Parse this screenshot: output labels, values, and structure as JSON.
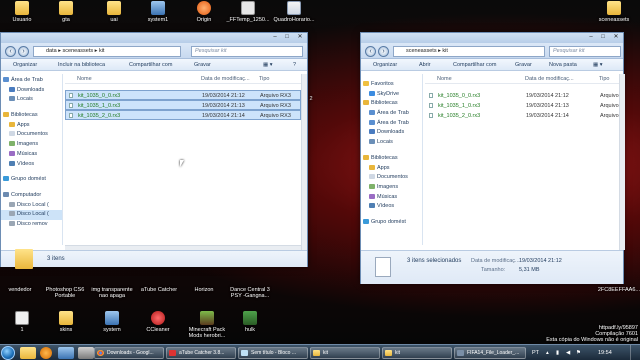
{
  "desktop": {
    "icons_top": [
      {
        "label": "Usuario",
        "icon": "user-folder-icon"
      },
      {
        "label": "gta",
        "icon": "folder-icon"
      },
      {
        "label": "uai",
        "icon": "folder-icon"
      },
      {
        "label": "system1",
        "icon": "system-icon"
      },
      {
        "label": "Origin",
        "icon": "origin-icon"
      },
      {
        "label": "_FFTemp_1250...",
        "icon": "file-icon"
      },
      {
        "label": "QuadroHorario...",
        "icon": "document-icon"
      },
      {
        "label": "sceneassets",
        "icon": "folder-icon"
      }
    ],
    "icons_middle": [
      {
        "label": "vendedor"
      },
      {
        "label": "Photoshop CS6 Portable"
      },
      {
        "label": "img transparente nao apaga"
      },
      {
        "label": "aTube Catcher"
      },
      {
        "label": "Horizon"
      },
      {
        "label": "Dance Central 3 PSY -Gangna..."
      }
    ],
    "icons_bottom": [
      {
        "label": "1",
        "icon": "file-icon"
      },
      {
        "label": "skins",
        "icon": "folder-icon"
      },
      {
        "label": "system",
        "icon": "system-icon"
      },
      {
        "label": "CCleaner",
        "icon": "ccleaner-icon"
      },
      {
        "label": "Minecraft Pack Mods herobri...",
        "icon": "minecraft-icon"
      },
      {
        "label": "hulk",
        "icon": "image-icon"
      }
    ],
    "right_text": [
      "2FC8EEFFAA6...",
      "httpadf.ly/95897",
      "Compilação 7601",
      "Esta cópia do Windows não é original"
    ],
    "edge_text": "2"
  },
  "left_window": {
    "breadcrumb": [
      "data",
      "sceneassets",
      "kit"
    ],
    "search_placeholder": "Pesquisar kit",
    "toolbar": [
      "Organizar",
      "Incluir na biblioteca",
      "Compartilhar com",
      "Gravar"
    ],
    "nav": [
      {
        "label": "Área de Trab",
        "icon": "desktop-icon"
      },
      {
        "label": "Downloads",
        "icon": "downloads-icon"
      },
      {
        "label": "Locais",
        "icon": "places-icon"
      },
      {
        "label": ""
      },
      {
        "label": "Bibliotecas",
        "icon": "libraries-icon"
      },
      {
        "label": "Apps",
        "icon": "folder-icon"
      },
      {
        "label": "Documentos",
        "icon": "documents-icon"
      },
      {
        "label": "Imagens",
        "icon": "images-icon"
      },
      {
        "label": "Músicas",
        "icon": "music-icon"
      },
      {
        "label": "Vídeos",
        "icon": "videos-icon"
      },
      {
        "label": ""
      },
      {
        "label": "Grupo domést",
        "icon": "homegroup-icon"
      },
      {
        "label": ""
      },
      {
        "label": "Computador",
        "icon": "computer-icon"
      },
      {
        "label": "Disco Local (",
        "icon": "disk-icon"
      },
      {
        "label": "Disco Local (",
        "icon": "disk-icon"
      },
      {
        "label": "Disco remov",
        "icon": "removable-disk-icon"
      }
    ],
    "columns": [
      "Nome",
      "Data de modificaç...",
      "Tipo"
    ],
    "files": [
      {
        "name": "kit_1035_0_0.rx3",
        "date": "19/03/2014 21:12",
        "type": "Arquivo RX3"
      },
      {
        "name": "kit_1035_1_0.rx3",
        "date": "19/03/2014 21:13",
        "type": "Arquivo RX3"
      },
      {
        "name": "kit_1035_2_0.rx3",
        "date": "19/03/2014 21:14",
        "type": "Arquivo RX3"
      }
    ],
    "status": "3 itens"
  },
  "right_window": {
    "breadcrumb": [
      "sceneassets",
      "kit"
    ],
    "search_placeholder": "Pesquisar kit",
    "toolbar": [
      "Organizar",
      "Abrir",
      "Compartilhar com",
      "Gravar",
      "Nova pasta"
    ],
    "nav": [
      {
        "label": "Favoritos",
        "icon": "favorites-icon"
      },
      {
        "label": "SkyDrive",
        "icon": "skydrive-icon"
      },
      {
        "label": "Bibliotecas",
        "icon": "libraries-icon"
      },
      {
        "label": "Área de Trab",
        "icon": "desktop-icon"
      },
      {
        "label": "Área de Trab",
        "icon": "desktop-icon"
      },
      {
        "label": "Downloads",
        "icon": "downloads-icon"
      },
      {
        "label": "Locais",
        "icon": "places-icon"
      },
      {
        "label": ""
      },
      {
        "label": "Bibliotecas",
        "icon": "libraries-icon"
      },
      {
        "label": "Apps",
        "icon": "folder-icon"
      },
      {
        "label": "Documentos",
        "icon": "documents-icon"
      },
      {
        "label": "Imagens",
        "icon": "images-icon"
      },
      {
        "label": "Músicas",
        "icon": "music-icon"
      },
      {
        "label": "Vídeos",
        "icon": "videos-icon"
      },
      {
        "label": ""
      },
      {
        "label": "Grupo domést",
        "icon": "homegroup-icon"
      }
    ],
    "columns": [
      "Nome",
      "Data de modificaç...",
      "Tipo"
    ],
    "files": [
      {
        "name": "kit_1035_0_0.rx3",
        "date": "19/03/2014 21:12",
        "type": "Arquivo R"
      },
      {
        "name": "kit_1035_1_0.rx3",
        "date": "19/03/2014 21:13",
        "type": "Arquivo R"
      },
      {
        "name": "kit_1035_2_0.rx3",
        "date": "19/03/2014 21:14",
        "type": "Arquivo R"
      }
    ],
    "status_selected": "3 itens selecionados",
    "status_date_label": "Data de modificaç...",
    "status_date": "19/03/2014 21:12",
    "status_size_label": "Tamanho:",
    "status_size": "5,31 MB"
  },
  "taskbar": {
    "buttons": [
      {
        "label": "Downloads - Googl...",
        "icon": "chrome-icon"
      },
      {
        "label": "aTube Catcher 3.8...",
        "icon": "atube-icon"
      },
      {
        "label": "Sem título - Bloco ...",
        "icon": "notepad-icon"
      },
      {
        "label": "kit",
        "icon": "folder-icon"
      },
      {
        "label": "kit",
        "icon": "folder-icon"
      },
      {
        "label": "FIFA14_File_Loader_...",
        "icon": "app-icon"
      }
    ],
    "lang": "PT",
    "clock": "19:54"
  },
  "colors": {
    "selection": "#cce3fb",
    "green_text": "#1f7a1f",
    "title": "#cfe0f3"
  }
}
